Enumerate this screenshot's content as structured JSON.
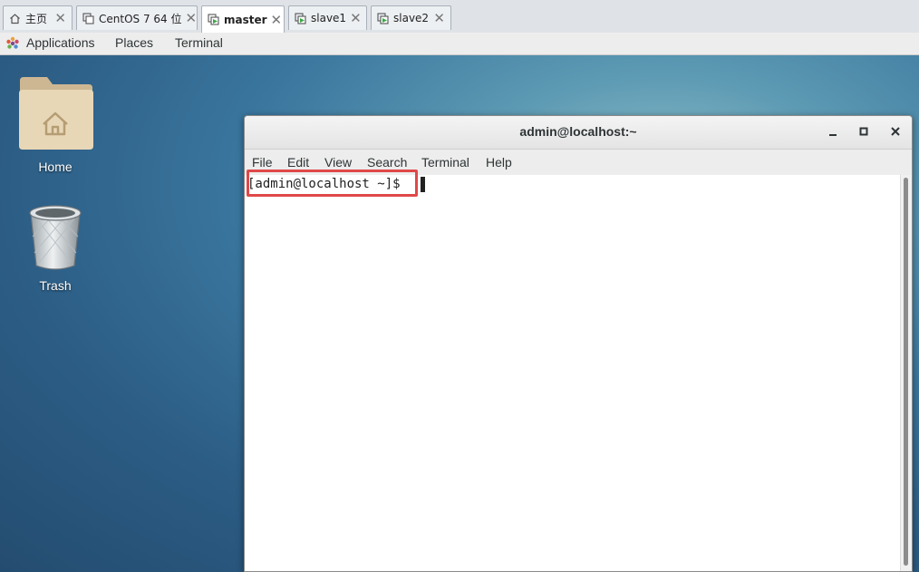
{
  "vm_tabs": [
    {
      "label": "主页",
      "icon": "home-icon"
    },
    {
      "label": "CentOS 7 64 位",
      "icon": "vm-icon"
    },
    {
      "label": "master",
      "icon": "vm-running-icon"
    },
    {
      "label": "slave1",
      "icon": "vm-running-icon"
    },
    {
      "label": "slave2",
      "icon": "vm-running-icon"
    }
  ],
  "topbar": {
    "applications": "Applications",
    "places": "Places",
    "terminal": "Terminal"
  },
  "desktop": {
    "home_label": "Home",
    "trash_label": "Trash"
  },
  "terminal_window": {
    "title": "admin@localhost:~",
    "menu": [
      "File",
      "Edit",
      "View",
      "Search",
      "Terminal",
      "Help"
    ],
    "prompt": "[admin@localhost ~]$",
    "highlight_color": "#e04848"
  }
}
